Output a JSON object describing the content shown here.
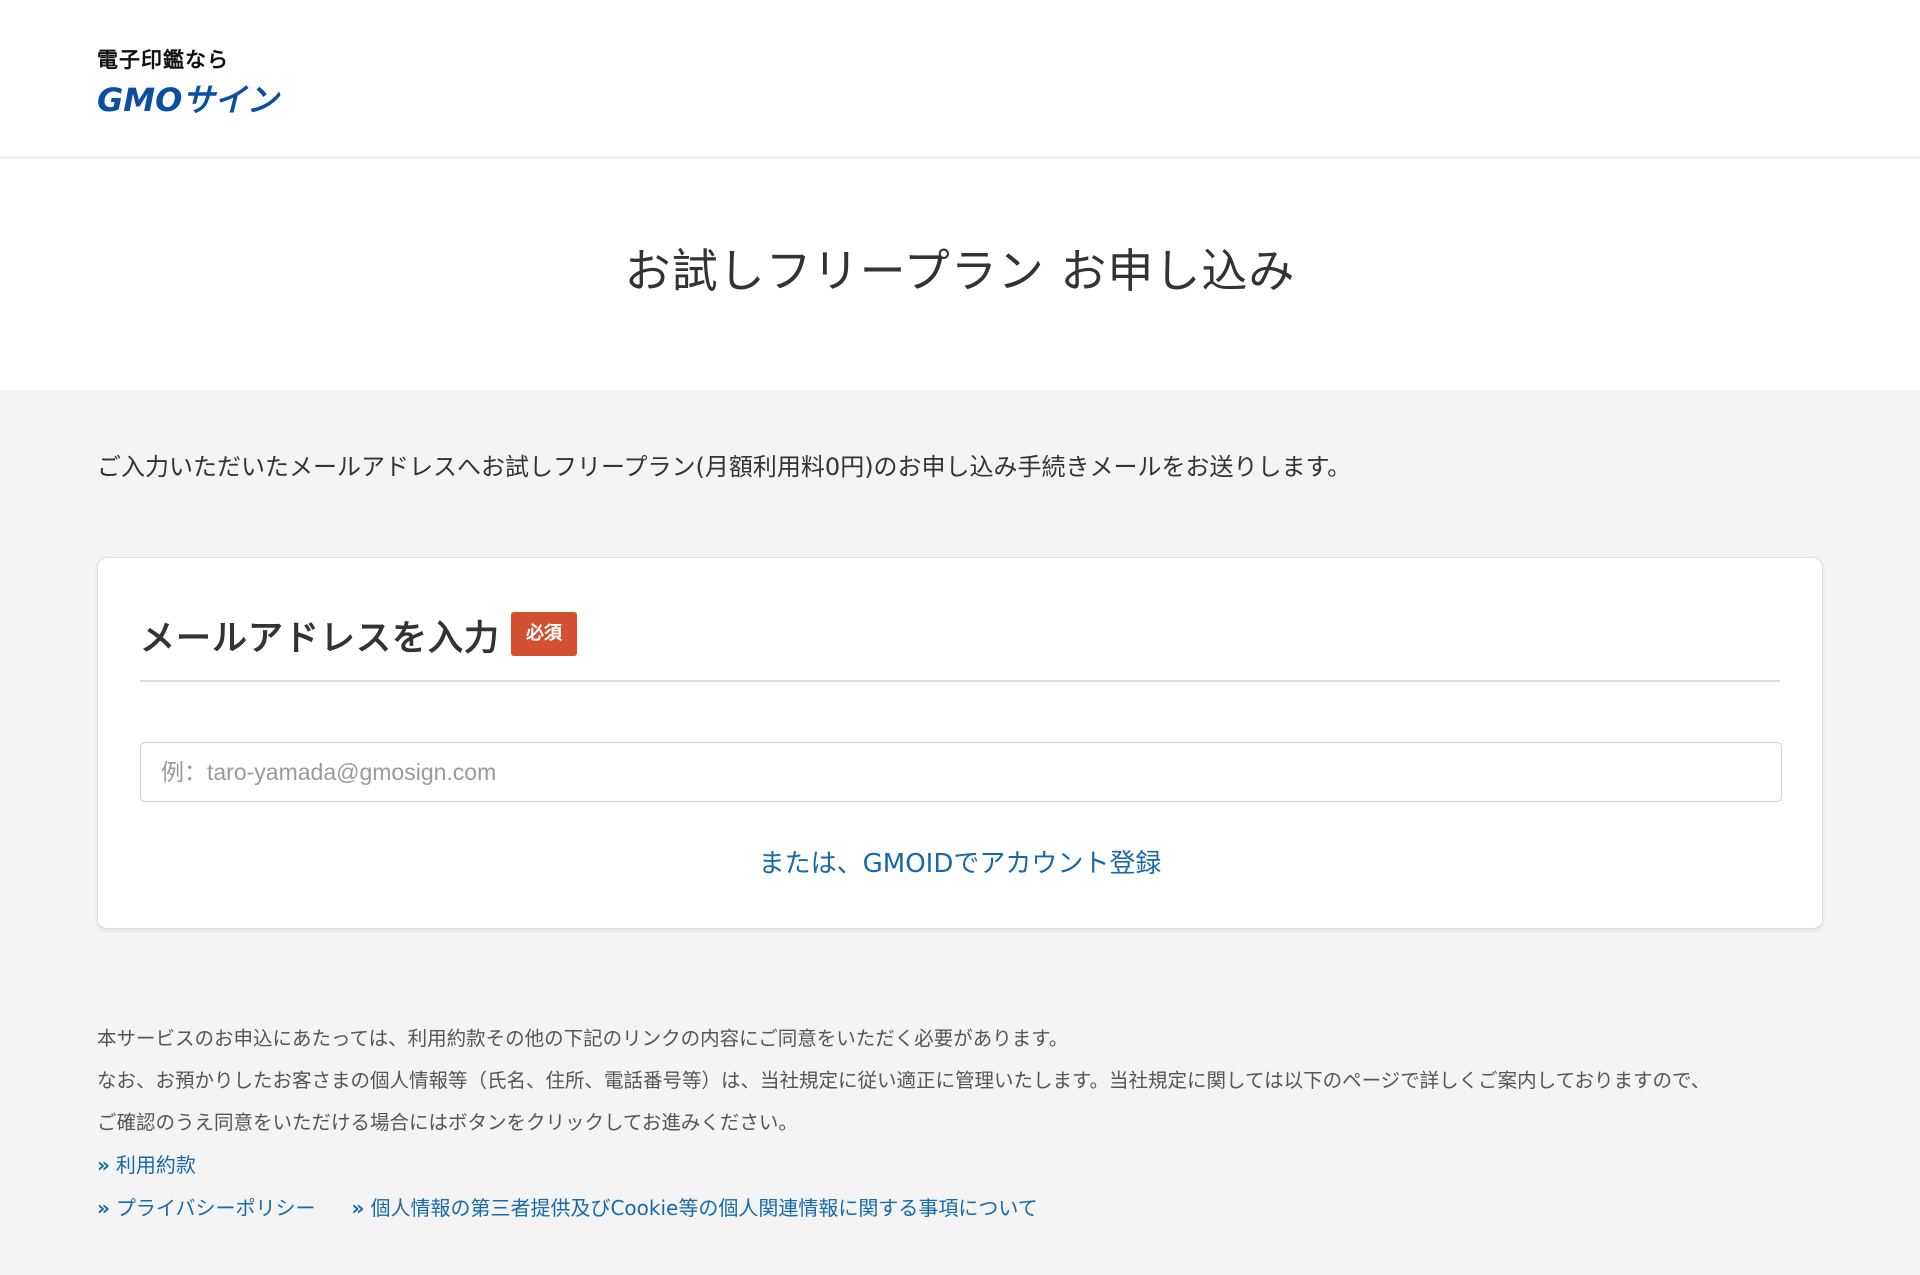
{
  "header": {
    "logo_tagline": "電子印鑑なら",
    "logo_wordmark": "GMOサイン"
  },
  "page_title": "お試しフリープラン お申し込み",
  "intro_text": "ご入力いただいたメールアドレスへお試しフリープラン(月額利用料0円)のお申し込み手続きメールをお送りします。",
  "email_card": {
    "title": "メールアドレスを入力",
    "required_badge": "必須",
    "input_placeholder": "例：taro-yamada@gmosign.com",
    "input_value": "",
    "gmoid_link": "または、GMOIDでアカウント登録"
  },
  "notes": {
    "line1": "本サービスのお申込にあたっては、利用約款その他の下記のリンクの内容にご同意をいただく必要があります。",
    "line2": "なお、お預かりしたお客さまの個人情報等（氏名、住所、電話番号等）は、当社規定に従い適正に管理いたします。当社規定に関しては以下のページで詳しくご案内しておりますので、",
    "line3": "ご確認のうえ同意をいただける場合にはボタンをクリックしてお進みください。",
    "link_prefix": "»",
    "links": {
      "terms": "利用約款",
      "privacy": "プライバシーポリシー",
      "third_party": "個人情報の第三者提供及びCookie等の個人関連情報に関する事項について"
    }
  },
  "colors": {
    "brand_blue": "#0b4ea2",
    "link_blue": "#1769aa",
    "required_red": "#d2502f",
    "page_bg": "#f4f4f4"
  }
}
